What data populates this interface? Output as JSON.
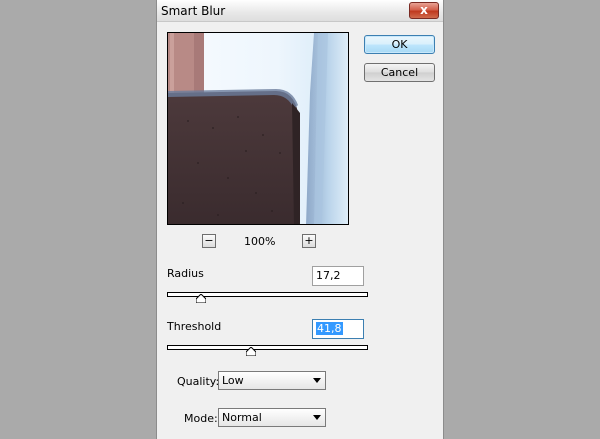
{
  "dialog": {
    "title": "Smart Blur",
    "close_glyph": "x",
    "ok_label": "OK",
    "cancel_label": "Cancel"
  },
  "preview": {
    "zoom_level": "100%",
    "zoom_out_glyph": "−",
    "zoom_in_glyph": "+"
  },
  "radius": {
    "label": "Radius",
    "value": "17,2",
    "slider_position": 0.17
  },
  "threshold": {
    "label": "Threshold",
    "value": "41,8",
    "slider_position": 0.42
  },
  "quality": {
    "label": "Quality:",
    "selected": "Low"
  },
  "mode": {
    "label": "Mode:",
    "selected": "Normal"
  },
  "colors": {
    "background": "#aaaaaa",
    "dialog_bg": "#f0f0f0",
    "selection": "#3399ff",
    "close_red": "#c0391f"
  }
}
